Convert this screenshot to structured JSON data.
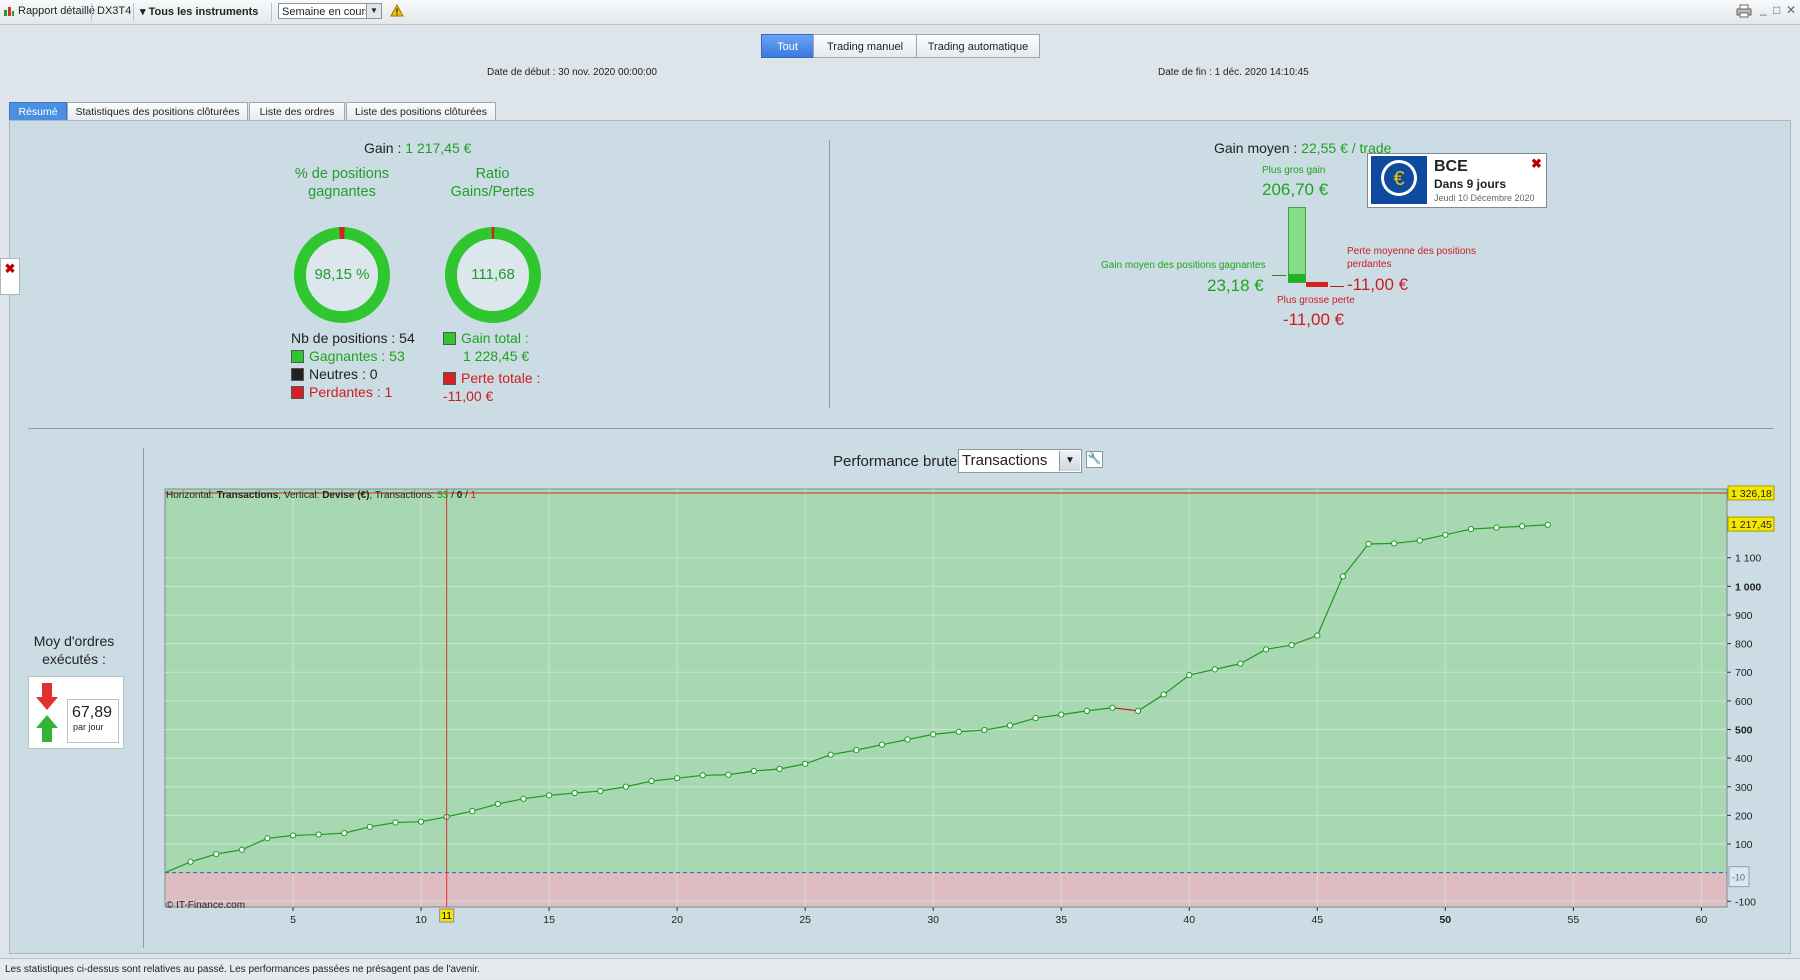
{
  "toolbar": {
    "report_label": "Rapport détaillé",
    "account": "DX3T4",
    "instruments": "Tous les instruments",
    "period": "Semaine en cours"
  },
  "modes": [
    "Tout",
    "Trading manuel",
    "Trading automatique"
  ],
  "dates": {
    "start": "Date de début : 30 nov. 2020 00:00:00",
    "end": "Date de fin : 1 déc. 2020 14:10:45"
  },
  "tabs": [
    "Résumé",
    "Statistiques des positions clôturées",
    "Liste des ordres",
    "Liste des positions clôturées"
  ],
  "summary": {
    "gain_label": "Gain :",
    "gain_value": "1 217,45 €",
    "pct_title": "% de positions gagnantes",
    "pct_value": "98,15 %",
    "pct_fraction": 0.9815,
    "ratio_title": "Ratio Gains/Pertes",
    "ratio_value": "111,68",
    "ratio_fraction": 0.991,
    "nb_positions": "Nb de positions : 54",
    "gagnantes": "Gagnantes : 53",
    "neutres": "Neutres : 0",
    "perdantes": "Perdantes : 1",
    "gain_total_label": "Gain total :",
    "gain_total_value": "1 228,45 €",
    "perte_totale_label": "Perte totale :",
    "perte_totale_value": "-11,00 €"
  },
  "gain_moyen": {
    "label": "Gain moyen :",
    "value": "22,55 € / trade",
    "plus_gros_gain_label": "Plus gros gain",
    "plus_gros_gain_value": "206,70 €",
    "gain_moyen_gagnantes_label": "Gain moyen des positions gagnantes",
    "gain_moyen_gagnantes_value": "23,18 €",
    "perte_moyenne_label_1": "Perte moyenne des positions",
    "perte_moyenne_label_2": "perdantes",
    "perte_moyenne_value": "-11,00 €",
    "plus_grosse_perte_label": "Plus grosse perte",
    "plus_grosse_perte_value": "-11,00 €"
  },
  "bce": {
    "title": "BCE",
    "subtitle": "Dans 9 jours",
    "date": "Jeudi 10 Décembre 2020"
  },
  "orders": {
    "title": "Moy d'ordres exécutés :",
    "value": "67,89",
    "unit": "par jour"
  },
  "performance": {
    "title": "Performance brute",
    "select_value": "Transactions"
  },
  "chart_data": {
    "type": "line",
    "header_prefix": "Horizontal: ",
    "header_h": "Transactions",
    "header_mid": ", Vertical: ",
    "header_v": "Devise (€)",
    "header_tx": ", Transactions: ",
    "header_win": "53",
    "header_sep1": " / ",
    "header_neutral": "0",
    "header_sep2": " / ",
    "header_loss": "1",
    "watermark": "© IT-Finance.com",
    "xlim": [
      0,
      61
    ],
    "ylim": [
      -120,
      1340
    ],
    "x_ticks": [
      5,
      10,
      15,
      20,
      25,
      30,
      35,
      40,
      45,
      50,
      55,
      60
    ],
    "x_bold_ticks": [
      50
    ],
    "y_ticks": [
      -100,
      100,
      200,
      300,
      400,
      500,
      600,
      700,
      800,
      900,
      1000,
      1100
    ],
    "y_bold_ticks": [
      500,
      1000
    ],
    "y_tick_labels": [
      "-100",
      "100",
      "200",
      "300",
      "400",
      "500",
      "600",
      "700",
      "800",
      "900",
      "1 000",
      "1 100"
    ],
    "max_label": "1 326,18",
    "max_value": 1326.18,
    "last_label": "1 217,45",
    "last_value": 1217.45,
    "zero_label": "-10",
    "cursor_x": 11,
    "cursor_label": "11",
    "loss_segment_index": 37,
    "colors": {
      "positive": "#a8d8b2",
      "negative": "#dfbcc2",
      "line": "#1e9a1e",
      "loss": "#d42020",
      "cursor": "#e03030"
    },
    "x": [
      0,
      1,
      2,
      3,
      4,
      5,
      6,
      7,
      8,
      9,
      10,
      11,
      12,
      13,
      14,
      15,
      16,
      17,
      18,
      19,
      20,
      21,
      22,
      23,
      24,
      25,
      26,
      27,
      28,
      29,
      30,
      31,
      32,
      33,
      34,
      35,
      36,
      37,
      38,
      39,
      40,
      41,
      42,
      43,
      44,
      45,
      46,
      47,
      48,
      49,
      50,
      51,
      52,
      53,
      54
    ],
    "y": [
      0,
      38,
      65,
      80,
      120,
      130,
      133,
      138,
      160,
      175,
      178,
      195,
      215,
      240,
      258,
      270,
      278,
      285,
      300,
      320,
      330,
      340,
      342,
      355,
      362,
      380,
      412,
      428,
      447,
      465,
      483,
      492,
      498,
      514,
      540,
      552,
      565,
      576,
      565,
      622,
      690,
      710,
      730,
      780,
      795,
      828,
      1035,
      1148,
      1150,
      1160,
      1180,
      1200,
      1205,
      1210,
      1215
    ]
  },
  "footer": "Les statistiques ci-dessus sont relatives au passé. Les performances passées ne présagent pas de l'avenir."
}
